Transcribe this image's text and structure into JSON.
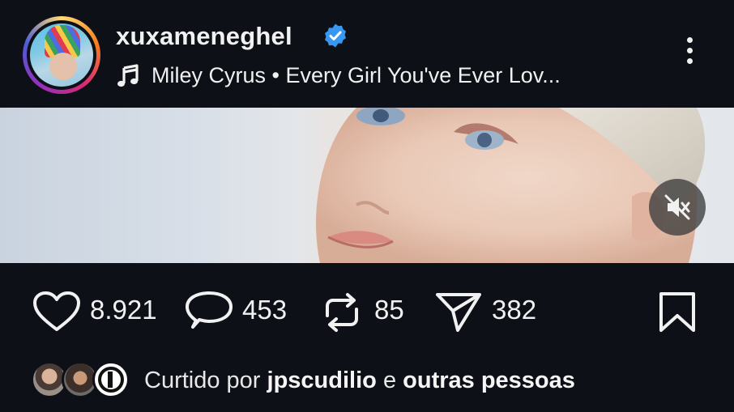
{
  "post": {
    "username": "xuxameneghel",
    "verified": true,
    "music": {
      "icon": "music-note-icon",
      "text": "Miley Cyrus • Every Girl You've Ever Lov..."
    },
    "menu_icon": "more-vertical-icon"
  },
  "media": {
    "audio_state_icon": "muted-speaker-icon",
    "muted": true
  },
  "actions": {
    "likes": "8.921",
    "comments": "453",
    "reposts": "85",
    "shares": "382"
  },
  "liked_by": {
    "prefix": "Curtido por",
    "user": "jpscudilio",
    "connector": "e",
    "others": "outras pessoas"
  },
  "colors": {
    "background": "#0d1117",
    "verified_badge": "#3897f0",
    "text": "#f1f1f1"
  }
}
